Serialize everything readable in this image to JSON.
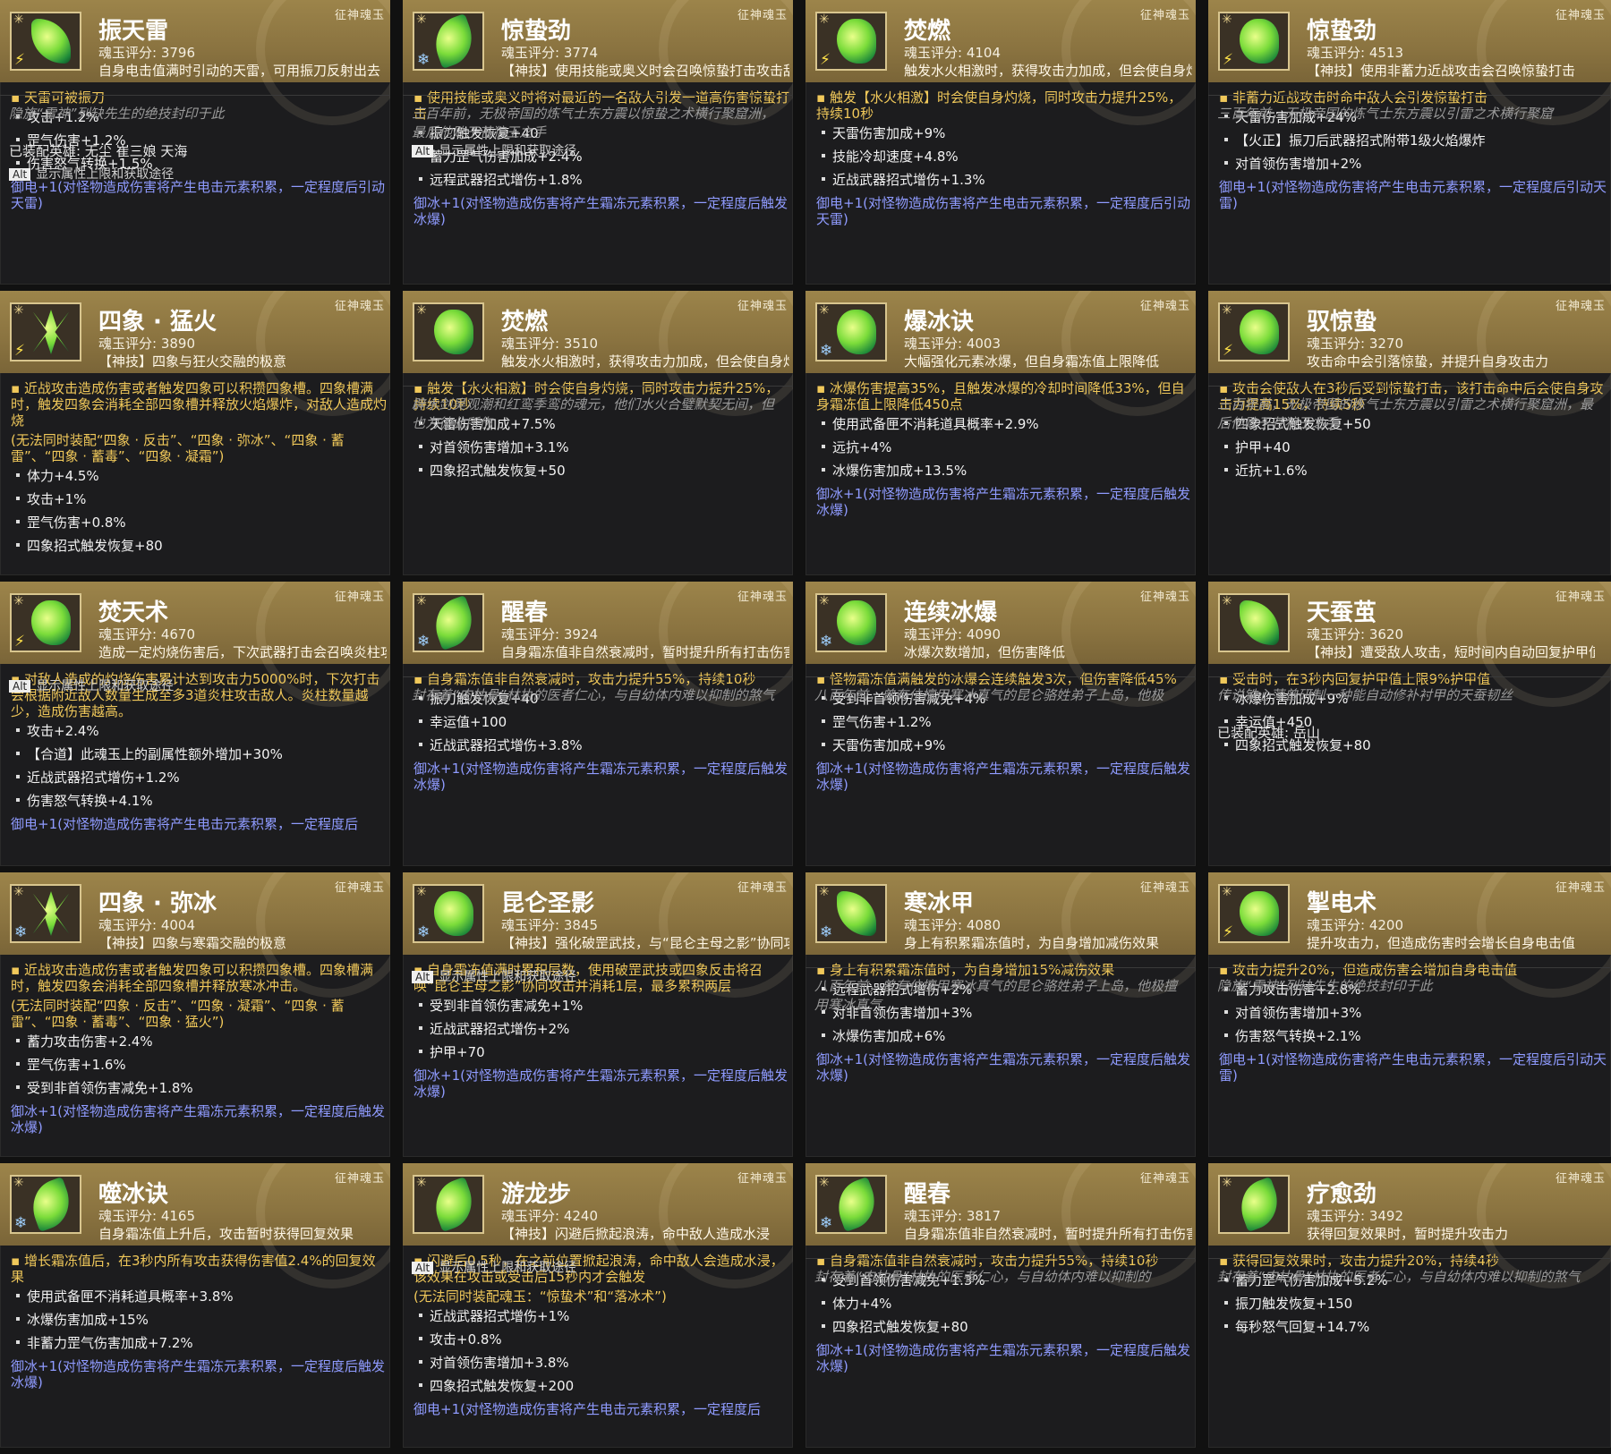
{
  "category_label": "征神魂玉",
  "alt_hint": {
    "key": "Alt",
    "text": "显示属性上限和获取途径"
  },
  "cards": [
    {
      "name": "振天雷",
      "score": "魂玉评分: 3796",
      "desc": "自身电击值满时引动的天雷，可用振刀反射出去",
      "main": "天雷可被振刀",
      "stats": [
        "攻击+1.2%",
        "罡气伤害+1.2%",
        "伤害怒气转换+1.5%"
      ],
      "blue": "御电+1(对怪物造成伤害将产生电击元素积累，一定程度后引动天雷)",
      "lore": "隐族“雷神”列缺先生的绝技封印于此",
      "hero": "已装配英雄: 无尘 崔三娘 天海",
      "element": "thunder",
      "gem": "leaf"
    },
    {
      "name": "惊蛰劲",
      "score": "魂玉评分: 3774",
      "desc": "【神技】使用技能或奥义时会召唤惊蛰打击攻击敌人",
      "main": "使用技能或奥义时将对最近的一名敌人引发一道高伤害惊蛰打击",
      "stats": [
        "振刀触发恢复+40",
        "蓄力罡气伤害加成+2.4%",
        "远程武器招式增伤+1.8%"
      ],
      "blue": "御冰+1(对怪物造成伤害将产生霜冻元素积累，一定程度后触发冰爆)",
      "lore": "三百年前，无极帝国的炼气士东方震以惊蛰之术横行聚窟洲，最后他败于苍狼王之手",
      "hero": "",
      "element": "ice",
      "gem": "blade"
    },
    {
      "name": "焚燃",
      "score": "魂玉评分: 4104",
      "desc": "触发水火相激时，获得攻击力加成，但会使自身灼烧",
      "main": "触发【水火相激】时会使自身灼烧，同时攻击力提升25%，持续10秒",
      "stats": [
        "天雷伤害加成+9%",
        "技能冷却速度+4.8%",
        "近战武器招式增伤+1.3%"
      ],
      "blue": "御电+1(对怪物造成伤害将产生电击元素积累，一定程度后引动天雷)",
      "lore": "",
      "hero": "",
      "element": "thunder",
      "gem": "beast"
    },
    {
      "name": "惊蛰劲",
      "score": "魂玉评分: 4513",
      "desc": "【神技】使用非蓄力近战攻击会召唤惊蛰打击",
      "main": "非蓄力近战攻击时命中敌人会引发惊蛰打击",
      "stats": [
        "天雷伤害加成+24%",
        "【火正】振刀后武器招式附带1级火焰爆炸",
        "对首领伤害增加+2%"
      ],
      "blue": "御电+1(对怪物造成伤害将产生电击元素积累，一定程度后引动天雷)",
      "lore": "三百年前，无极帝国的炼气士东方震以引雷之术横行聚窟",
      "hero": "",
      "element": "thunder",
      "gem": "beast"
    },
    {
      "name": "四象 · 猛火",
      "score": "魂玉评分: 3890",
      "desc": "【神技】四象与狂火交融的极意",
      "main": "近战攻击造成伤害或者触发四象可以积攒四象槽。四象槽满时，触发四象会消耗全部四象槽并释放火焰爆炸，对敌人造成灼烧",
      "note": "(无法同时装配“四象 · 反击”、“四象 · 弥冰”、“四象 · 蓄雷”、“四象 · 蓄毒”、“四象 · 凝霜”)",
      "stats": [
        "体力+4.5%",
        "攻击+1%",
        "罡气伤害+0.8%",
        "四象招式触发恢复+80"
      ],
      "blue": "",
      "lore": "",
      "hero": "",
      "element": "thunder",
      "gem": "cross"
    },
    {
      "name": "焚燃",
      "score": "魂玉评分: 3510",
      "desc": "触发水火相激时，获得攻击力加成，但会使自身灼烧",
      "main": "触发【水火相激】时会使自身灼烧，同时攻击力提升25%，持续10秒",
      "stats": [
        "天雷伤害加成+7.5%",
        "对首领伤害增加+3.1%",
        "四象招式触发恢复+50"
      ],
      "blue": "",
      "lore": "辟水剑吴观潮和红鸾季鸾的魂元，他们水火合璧默契无间，但也为彼此所伤",
      "hero": "",
      "element": "",
      "gem": "beast"
    },
    {
      "name": "爆冰诀",
      "score": "魂玉评分: 4003",
      "desc": "大幅强化元素冰爆，但自身霜冻值上限降低",
      "main": "冰爆伤害提高35%，且触发冰爆的冷却时间降低33%，但自身霜冻值上限降低450点",
      "stats": [
        "使用武备匣不消耗道具概率+2.9%",
        "远抗+4%",
        "冰爆伤害加成+13.5%"
      ],
      "blue": "御冰+1(对怪物造成伤害将产生霜冻元素积累，一定程度后触发冰爆)",
      "lore": "",
      "hero": "",
      "element": "ice",
      "gem": "beast"
    },
    {
      "name": "驭惊蛰",
      "score": "魂玉评分: 3270",
      "desc": "攻击命中会引落惊蛰，并提升自身攻击力",
      "main": "攻击会使敌人在3秒后受到惊蛰打击，该打击命中后会使自身攻击力提高15%，持续5秒",
      "stats": [
        "四象招式触发恢复+50",
        "护甲+40",
        "近抗+1.6%"
      ],
      "blue": "",
      "lore": "三百年前，无极帝国的炼气士东方震以引雷之术横行聚窟洲，最后他败于苍狼王之手",
      "hero": "",
      "element": "thunder",
      "gem": "beast"
    },
    {
      "name": "焚天术",
      "score": "魂玉评分: 4670",
      "desc": "造成一定灼烧伤害后，下次武器打击会召唤炎柱攻击敌人",
      "main": "对敌人造成的灼烧伤害累计达到攻击力5000%时，下次打击会根据附近敌人数量生成至多3道炎柱攻击敌人。炎柱数量越少，造成伤害越高。",
      "stats": [
        "攻击+2.4%",
        "【合道】此魂玉上的副属性额外增加+30%",
        "近战武器招式增伤+1.2%",
        "伤害怒气转换+4.1%"
      ],
      "blue": "御电+1(对怪物造成伤害将产生电击元素积累，一定程度后",
      "lore": "",
      "hero": "",
      "element": "thunder",
      "gem": "beast"
    },
    {
      "name": "醒春",
      "score": "魂玉评分: 3924",
      "desc": "自身霜冻值非自然衰减时，暂时提升所有打击伤害",
      "main": "自身霜冻值非自然衰减时，攻击力提升55%，持续10秒",
      "stats": [
        "振刀触发恢复+40",
        "幸运值+100",
        "近战武器招式增伤+3.8%"
      ],
      "blue": "御冰+1(对怪物造成伤害将产生霜冻元素积累，一定程度后触发冰爆)",
      "lore": "封存着“肉枯骨”林执的医者仁心，与自幼体内难以抑制的煞气",
      "hero": "",
      "element": "ice",
      "gem": "blade"
    },
    {
      "name": "连续冰爆",
      "score": "魂玉评分: 4090",
      "desc": "冰爆次数增加，但伤害降低",
      "main": "怪物霜冻值满触发的冰爆会连续触发3次，但伤害降低45%",
      "stats": [
        "受到非首领伤害减免+4%",
        "罡气伤害+1.2%",
        "天雷伤害加成+9%"
      ],
      "blue": "御冰+1(对怪物造成伤害将产生霜冻元素积累，一定程度后触发冰爆)",
      "lore": "八百年前，曾有位擅用寒冰真气的昆仑骆姓弟子上岛，他极",
      "hero": "",
      "element": "ice",
      "gem": "beast"
    },
    {
      "name": "天蚕茧",
      "score": "魂玉评分: 3620",
      "desc": "【神技】遭受敌人攻击，短时间内自动回复护甲值",
      "main": "受击时，在3秒内回复护甲值上限9%护甲值",
      "stats": [
        "冰爆伤害加成+9%",
        "幸运值+450",
        "四象招式触发恢复+80"
      ],
      "blue": "",
      "lore": "传说铁心萍曾研制一种能自动修补衬甲的天蚕韧丝",
      "hero": "已装配英雄: 岳山",
      "element": "",
      "gem": "leaf"
    },
    {
      "name": "四象 · 弥冰",
      "score": "魂玉评分: 4004",
      "desc": "【神技】四象与寒霜交融的极意",
      "main": "近战攻击造成伤害或者触发四象可以积攒四象槽。四象槽满时，触发四象会消耗全部四象槽并释放寒冰冲击。",
      "note": "(无法同时装配“四象 · 反击”、“四象 · 凝霜”、“四象 · 蓄雷”、“四象 · 蓄毒”、“四象 · 猛火”)",
      "stats": [
        "蓄力攻击伤害+2.4%",
        "罡气伤害+1.6%",
        "受到非首领伤害减免+1.8%"
      ],
      "blue": "御冰+1(对怪物造成伤害将产生霜冻元素积累，一定程度后触发冰爆)",
      "lore": "",
      "hero": "",
      "element": "ice",
      "gem": "cross"
    },
    {
      "name": "昆仑圣影",
      "score": "魂玉评分: 3845",
      "desc": "【神技】强化破罡武技，与“昆仑主母之影”协同攻敌",
      "main": "自身霜冻值满时累积层数，使用破罡武技或四象反击将召唤“昆仑主母之影”协同攻击并消耗1层，最多累积两层",
      "stats": [
        "受到非首领伤害减免+1%",
        "近战武器招式增伤+2%",
        "护甲+70"
      ],
      "blue": "御冰+1(对怪物造成伤害将产生霜冻元素积累，一定程度后触发冰爆)",
      "lore": "",
      "hero": "",
      "element": "ice",
      "gem": "beast"
    },
    {
      "name": "寒冰甲",
      "score": "魂玉评分: 4080",
      "desc": "身上有积累霜冻值时，为自身增加减伤效果",
      "main": "身上有积累霜冻值时，为自身增加15%减伤效果",
      "stats": [
        "远程武器招式增伤+2%",
        "对非首领伤害增加+3%",
        "冰爆伤害加成+6%"
      ],
      "blue": "御冰+1(对怪物造成伤害将产生霜冻元素积累，一定程度后触发冰爆)",
      "lore": "八百年前，曾有位擅用寒冰真气的昆仑骆姓弟子上岛，他极擅用寒冰真气",
      "hero": "",
      "element": "ice",
      "gem": "leaf"
    },
    {
      "name": "掣电术",
      "score": "魂玉评分: 4200",
      "desc": "提升攻击力，但造成伤害时会增长自身电击值",
      "main": "攻击力提升20%，但造成伤害会增加自身电击值",
      "stats": [
        "蓄力攻击伤害+2.8%",
        "对首领伤害增加+3%",
        "伤害怒气转换+2.1%"
      ],
      "blue": "御电+1(对怪物造成伤害将产生电击元素积累，一定程度后引动天雷)",
      "lore": "隐族“雷神”列缺先生的绝技封印于此",
      "hero": "",
      "element": "thunder",
      "gem": "beast"
    },
    {
      "name": "噬冰诀",
      "score": "魂玉评分: 4165",
      "desc": "自身霜冻值上升后，攻击暂时获得回复效果",
      "main": "增长霜冻值后，在3秒内所有攻击获得伤害值2.4%的回复效果",
      "stats": [
        "使用武备匣不消耗道具概率+3.8%",
        "冰爆伤害加成+15%",
        "非蓄力罡气伤害加成+7.2%"
      ],
      "blue": "御冰+1(对怪物造成伤害将产生霜冻元素积累，一定程度后触发冰爆)",
      "lore": "",
      "hero": "",
      "element": "ice",
      "gem": "blade"
    },
    {
      "name": "游龙步",
      "score": "魂玉评分: 4240",
      "desc": "【神技】闪避后掀起浪涛，命中敌人造成水浸",
      "main": "闪避后0.5秒，在之前位置掀起浪涛，命中敌人会造成水浸，该效果在攻击或受击后15秒内才会触发",
      "note": "(无法同时装配魂玉：“惊蛰术”和“落冰术”)",
      "stats": [
        "近战武器招式增伤+1%",
        "攻击+0.8%",
        "对首领伤害增加+3.8%",
        "四象招式触发恢复+200"
      ],
      "blue": "御电+1(对怪物造成伤害将产生电击元素积累，一定程度后",
      "lore": "",
      "hero": "",
      "element": "",
      "gem": "blade"
    },
    {
      "name": "醒春",
      "score": "魂玉评分: 3817",
      "desc": "自身霜冻值非自然衰减时，暂时提升所有打击伤害",
      "main": "自身霜冻值非自然衰减时，攻击力提升55%，持续10秒",
      "stats": [
        "受到首领伤害减免+1.3%",
        "体力+4%",
        "四象招式触发恢复+80"
      ],
      "blue": "御冰+1(对怪物造成伤害将产生霜冻元素积累，一定程度后触发冰爆)",
      "lore": "封存着“肉枯骨”林执的医者仁心，与自幼体内难以抑制的",
      "hero": "",
      "element": "ice",
      "gem": "blade"
    },
    {
      "name": "疗愈劲",
      "score": "魂玉评分: 3492",
      "desc": "获得回复效果时，暂时提升攻击力",
      "main": "获得回复效果时，攻击力提升20%，持续4秒",
      "stats": [
        "蓄力罡气伤害加成+5.2%",
        "振刀触发恢复+150",
        "每秒怒气回复+14.7%"
      ],
      "blue": "",
      "lore": "封存着“肉枯骨”林执的医者仁心，与自幼体内难以抑制的煞气",
      "hero": "",
      "element": "",
      "gem": "blade"
    }
  ]
}
